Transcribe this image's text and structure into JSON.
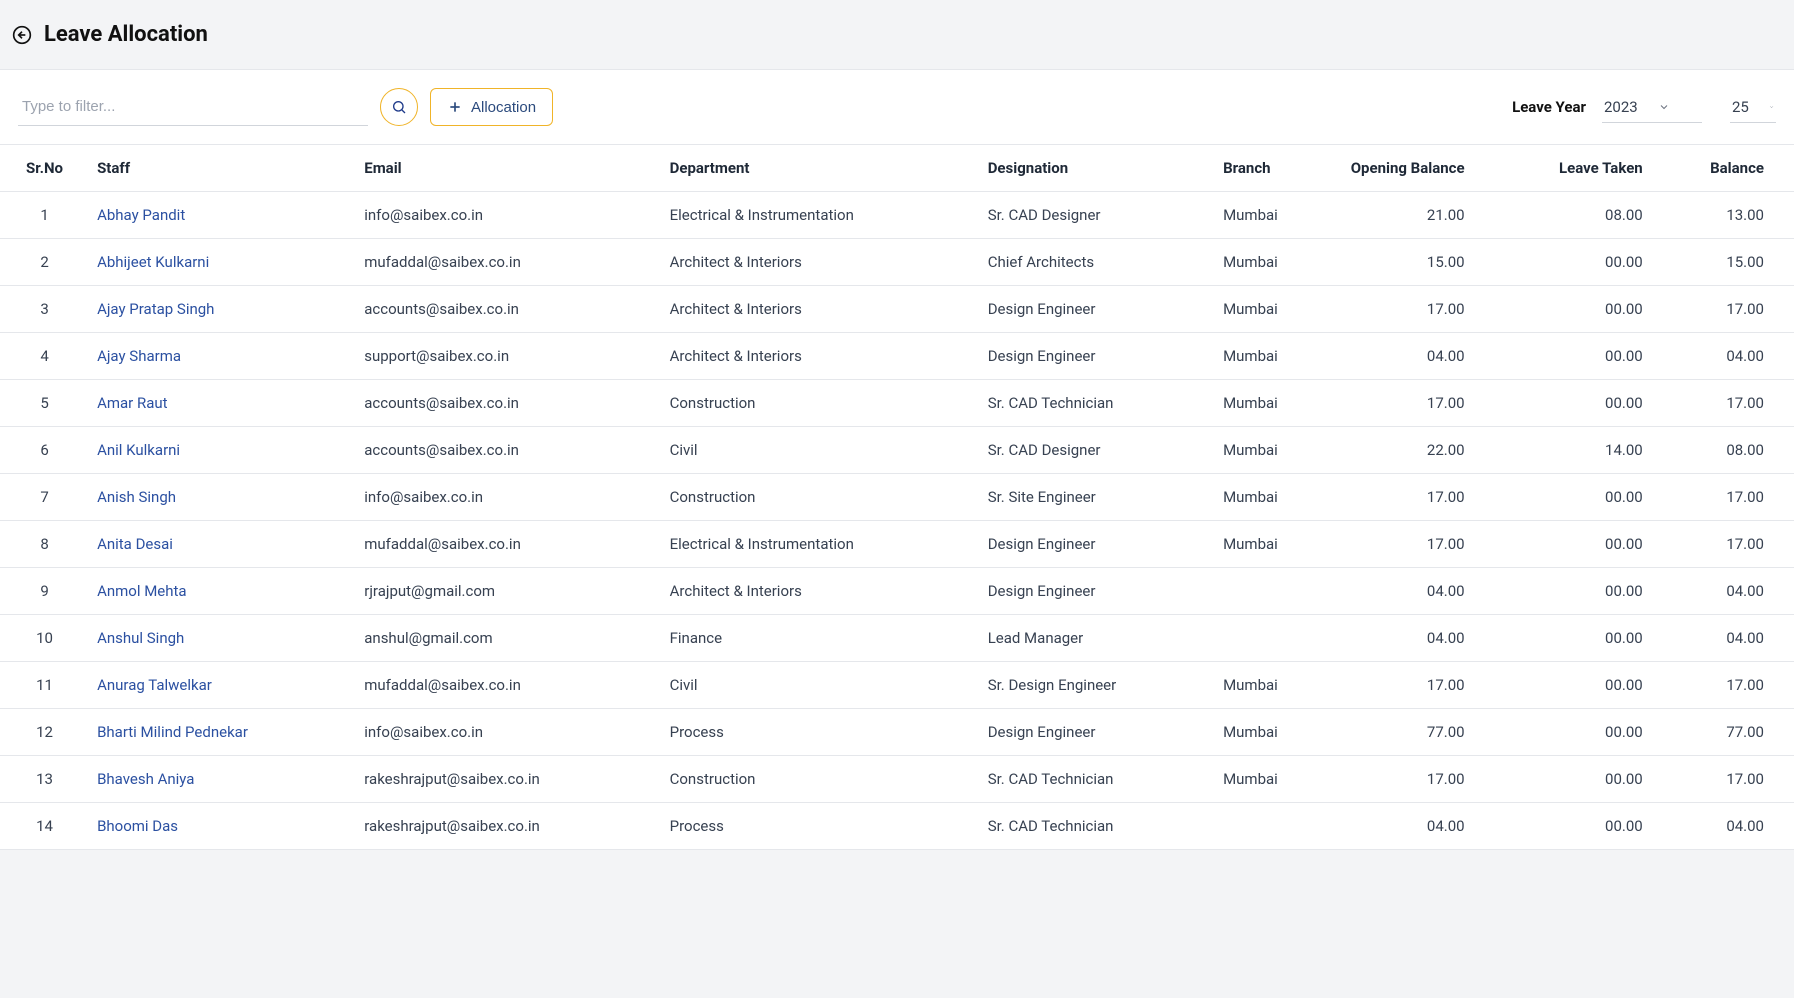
{
  "header": {
    "title": "Leave Allocation"
  },
  "toolbar": {
    "filter_placeholder": "Type to filter...",
    "allocation_label": "Allocation",
    "leave_year_label": "Leave Year",
    "year_value": "2023",
    "page_size": "25"
  },
  "columns": {
    "sr": "Sr.No",
    "staff": "Staff",
    "email": "Email",
    "dept": "Department",
    "desig": "Designation",
    "branch": "Branch",
    "open": "Opening Balance",
    "taken": "Leave Taken",
    "bal": "Balance"
  },
  "rows": [
    {
      "sr": "1",
      "staff": "Abhay Pandit",
      "email": "info@saibex.co.in",
      "dept": "Electrical & Instrumentation",
      "desig": "Sr. CAD Designer",
      "branch": "Mumbai",
      "open": "21.00",
      "taken": "08.00",
      "bal": "13.00"
    },
    {
      "sr": "2",
      "staff": "Abhijeet Kulkarni",
      "email": "mufaddal@saibex.co.in",
      "dept": "Architect & Interiors",
      "desig": "Chief Architects",
      "branch": "Mumbai",
      "open": "15.00",
      "taken": "00.00",
      "bal": "15.00"
    },
    {
      "sr": "3",
      "staff": "Ajay Pratap Singh",
      "email": "accounts@saibex.co.in",
      "dept": "Architect & Interiors",
      "desig": "Design Engineer",
      "branch": "Mumbai",
      "open": "17.00",
      "taken": "00.00",
      "bal": "17.00"
    },
    {
      "sr": "4",
      "staff": "Ajay Sharma",
      "email": "support@saibex.co.in",
      "dept": "Architect & Interiors",
      "desig": "Design Engineer",
      "branch": "Mumbai",
      "open": "04.00",
      "taken": "00.00",
      "bal": "04.00"
    },
    {
      "sr": "5",
      "staff": "Amar Raut",
      "email": "accounts@saibex.co.in",
      "dept": "Construction",
      "desig": "Sr. CAD Technician",
      "branch": "Mumbai",
      "open": "17.00",
      "taken": "00.00",
      "bal": "17.00"
    },
    {
      "sr": "6",
      "staff": "Anil Kulkarni",
      "email": "accounts@saibex.co.in",
      "dept": "Civil",
      "desig": "Sr. CAD Designer",
      "branch": "Mumbai",
      "open": "22.00",
      "taken": "14.00",
      "bal": "08.00"
    },
    {
      "sr": "7",
      "staff": "Anish Singh",
      "email": "info@saibex.co.in",
      "dept": "Construction",
      "desig": "Sr. Site Engineer",
      "branch": "Mumbai",
      "open": "17.00",
      "taken": "00.00",
      "bal": "17.00"
    },
    {
      "sr": "8",
      "staff": "Anita Desai",
      "email": "mufaddal@saibex.co.in",
      "dept": "Electrical & Instrumentation",
      "desig": "Design Engineer",
      "branch": "Mumbai",
      "open": "17.00",
      "taken": "00.00",
      "bal": "17.00"
    },
    {
      "sr": "9",
      "staff": "Anmol Mehta",
      "email": "rjrajput@gmail.com",
      "dept": "Architect & Interiors",
      "desig": "Design Engineer",
      "branch": "",
      "open": "04.00",
      "taken": "00.00",
      "bal": "04.00"
    },
    {
      "sr": "10",
      "staff": "Anshul Singh",
      "email": "anshul@gmail.com",
      "dept": "Finance",
      "desig": "Lead Manager",
      "branch": "",
      "open": "04.00",
      "taken": "00.00",
      "bal": "04.00"
    },
    {
      "sr": "11",
      "staff": "Anurag Talwelkar",
      "email": "mufaddal@saibex.co.in",
      "dept": "Civil",
      "desig": "Sr. Design Engineer",
      "branch": "Mumbai",
      "open": "17.00",
      "taken": "00.00",
      "bal": "17.00"
    },
    {
      "sr": "12",
      "staff": "Bharti Milind Pednekar",
      "email": "info@saibex.co.in",
      "dept": "Process",
      "desig": "Design Engineer",
      "branch": "Mumbai",
      "open": "77.00",
      "taken": "00.00",
      "bal": "77.00"
    },
    {
      "sr": "13",
      "staff": "Bhavesh Aniya",
      "email": "rakeshrajput@saibex.co.in",
      "dept": "Construction",
      "desig": "Sr. CAD Technician",
      "branch": "Mumbai",
      "open": "17.00",
      "taken": "00.00",
      "bal": "17.00"
    },
    {
      "sr": "14",
      "staff": "Bhoomi Das",
      "email": "rakeshrajput@saibex.co.in",
      "dept": "Process",
      "desig": "Sr. CAD Technician",
      "branch": "",
      "open": "04.00",
      "taken": "00.00",
      "bal": "04.00"
    }
  ]
}
